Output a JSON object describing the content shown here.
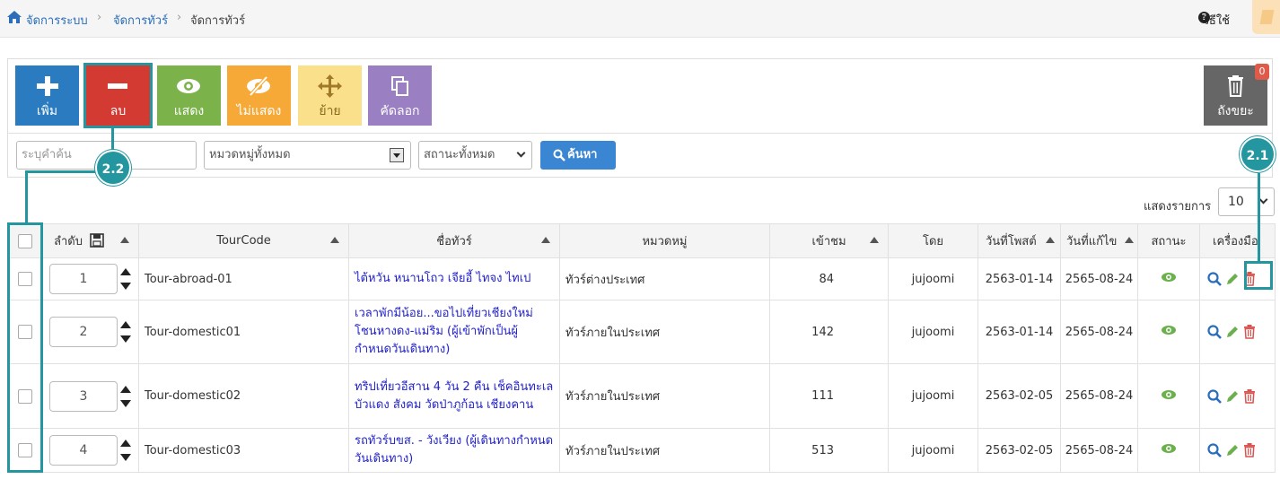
{
  "breadcrumb": {
    "items": [
      {
        "label": "จัดการระบบ"
      },
      {
        "label": "จัดการทัวร์"
      },
      {
        "label": "จัดการทัวร์"
      }
    ]
  },
  "help": {
    "label": "วิธีใช้"
  },
  "toolbar": {
    "add_label": "เพิ่ม",
    "delete_label": "ลบ",
    "show_label": "แสดง",
    "hide_label": "ไม่แสดง",
    "move_label": "ย้าย",
    "copy_label": "คัดลอก",
    "trash_label": "ถังขยะ",
    "trash_count": "0",
    "colors": {
      "add": "#2b7bc0",
      "delete": "#d33a32",
      "show": "#7bb24a",
      "hide": "#f7a938",
      "move": "#fbe08c",
      "copy": "#9a7fc2",
      "trash": "#666666",
      "accent": "#2496a0"
    }
  },
  "filters": {
    "search_placeholder": "ระบุคำค้น",
    "category_value": "หมวดหมู่ทั้งหมด",
    "status_value": "สถานะทั้งหมด",
    "search_button": "ค้นหา"
  },
  "callouts": {
    "a": "2.1",
    "b": "2.2"
  },
  "pagesize": {
    "label": "แสดงรายการ",
    "value": "10"
  },
  "table": {
    "headers": {
      "order": "ลำดับ",
      "tourcode": "TourCode",
      "name": "ชื่อทัวร์",
      "category": "หมวดหมู่",
      "views": "เข้าชม",
      "by": "โดย",
      "posted": "วันที่โพสต์",
      "edited": "วันที่แก้ไข",
      "status": "สถานะ",
      "tools": "เครื่องมือ"
    },
    "rows": [
      {
        "order": "1",
        "code": "Tour-abroad-01",
        "name": "ไต้หวัน หนานโถว เจียอี้ ไทจง ไทเป",
        "category": "ทัวร์ต่างประเทศ",
        "views": "84",
        "by": "jujoomi",
        "posted": "2563-01-14",
        "edited": "2565-08-24"
      },
      {
        "order": "2",
        "code": "Tour-domestic01",
        "name": "เวลาพักมีน้อย...ขอไปเที่ยวเชียงใหม่ โชนหางดง-แม่ริม (ผู้เข้าพักเป็นผู้กำหนดวันเดินทาง)",
        "category": "ทัวร์ภายในประเทศ",
        "views": "142",
        "by": "jujoomi",
        "posted": "2563-01-14",
        "edited": "2565-08-24"
      },
      {
        "order": "3",
        "code": "Tour-domestic02",
        "name": "ทริปเที่ยวอีสาน 4 วัน 2 คืน เช็คอินทะเลบัวแดง สังคม วัดป่าภูก้อน เชียงคาน",
        "category": "ทัวร์ภายในประเทศ",
        "views": "111",
        "by": "jujoomi",
        "posted": "2563-02-05",
        "edited": "2565-08-24"
      },
      {
        "order": "4",
        "code": "Tour-domestic03",
        "name": "รถทัวร์บขส. - วังเวียง (ผู้เดินทางกำหนดวันเดินทาง)",
        "category": "ทัวร์ภายในประเทศ",
        "views": "513",
        "by": "jujoomi",
        "posted": "2563-02-05",
        "edited": "2565-08-24"
      }
    ]
  }
}
